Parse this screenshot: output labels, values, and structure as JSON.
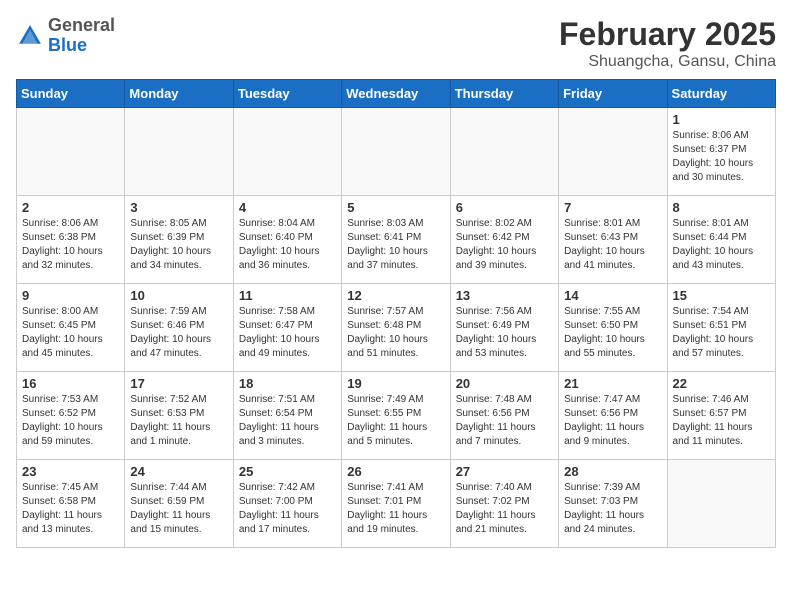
{
  "header": {
    "logo_general": "General",
    "logo_blue": "Blue",
    "month_title": "February 2025",
    "location": "Shuangcha, Gansu, China"
  },
  "weekdays": [
    "Sunday",
    "Monday",
    "Tuesday",
    "Wednesday",
    "Thursday",
    "Friday",
    "Saturday"
  ],
  "weeks": [
    [
      {
        "day": "",
        "info": ""
      },
      {
        "day": "",
        "info": ""
      },
      {
        "day": "",
        "info": ""
      },
      {
        "day": "",
        "info": ""
      },
      {
        "day": "",
        "info": ""
      },
      {
        "day": "",
        "info": ""
      },
      {
        "day": "1",
        "info": "Sunrise: 8:06 AM\nSunset: 6:37 PM\nDaylight: 10 hours and 30 minutes."
      }
    ],
    [
      {
        "day": "2",
        "info": "Sunrise: 8:06 AM\nSunset: 6:38 PM\nDaylight: 10 hours and 32 minutes."
      },
      {
        "day": "3",
        "info": "Sunrise: 8:05 AM\nSunset: 6:39 PM\nDaylight: 10 hours and 34 minutes."
      },
      {
        "day": "4",
        "info": "Sunrise: 8:04 AM\nSunset: 6:40 PM\nDaylight: 10 hours and 36 minutes."
      },
      {
        "day": "5",
        "info": "Sunrise: 8:03 AM\nSunset: 6:41 PM\nDaylight: 10 hours and 37 minutes."
      },
      {
        "day": "6",
        "info": "Sunrise: 8:02 AM\nSunset: 6:42 PM\nDaylight: 10 hours and 39 minutes."
      },
      {
        "day": "7",
        "info": "Sunrise: 8:01 AM\nSunset: 6:43 PM\nDaylight: 10 hours and 41 minutes."
      },
      {
        "day": "8",
        "info": "Sunrise: 8:01 AM\nSunset: 6:44 PM\nDaylight: 10 hours and 43 minutes."
      }
    ],
    [
      {
        "day": "9",
        "info": "Sunrise: 8:00 AM\nSunset: 6:45 PM\nDaylight: 10 hours and 45 minutes."
      },
      {
        "day": "10",
        "info": "Sunrise: 7:59 AM\nSunset: 6:46 PM\nDaylight: 10 hours and 47 minutes."
      },
      {
        "day": "11",
        "info": "Sunrise: 7:58 AM\nSunset: 6:47 PM\nDaylight: 10 hours and 49 minutes."
      },
      {
        "day": "12",
        "info": "Sunrise: 7:57 AM\nSunset: 6:48 PM\nDaylight: 10 hours and 51 minutes."
      },
      {
        "day": "13",
        "info": "Sunrise: 7:56 AM\nSunset: 6:49 PM\nDaylight: 10 hours and 53 minutes."
      },
      {
        "day": "14",
        "info": "Sunrise: 7:55 AM\nSunset: 6:50 PM\nDaylight: 10 hours and 55 minutes."
      },
      {
        "day": "15",
        "info": "Sunrise: 7:54 AM\nSunset: 6:51 PM\nDaylight: 10 hours and 57 minutes."
      }
    ],
    [
      {
        "day": "16",
        "info": "Sunrise: 7:53 AM\nSunset: 6:52 PM\nDaylight: 10 hours and 59 minutes."
      },
      {
        "day": "17",
        "info": "Sunrise: 7:52 AM\nSunset: 6:53 PM\nDaylight: 11 hours and 1 minute."
      },
      {
        "day": "18",
        "info": "Sunrise: 7:51 AM\nSunset: 6:54 PM\nDaylight: 11 hours and 3 minutes."
      },
      {
        "day": "19",
        "info": "Sunrise: 7:49 AM\nSunset: 6:55 PM\nDaylight: 11 hours and 5 minutes."
      },
      {
        "day": "20",
        "info": "Sunrise: 7:48 AM\nSunset: 6:56 PM\nDaylight: 11 hours and 7 minutes."
      },
      {
        "day": "21",
        "info": "Sunrise: 7:47 AM\nSunset: 6:56 PM\nDaylight: 11 hours and 9 minutes."
      },
      {
        "day": "22",
        "info": "Sunrise: 7:46 AM\nSunset: 6:57 PM\nDaylight: 11 hours and 11 minutes."
      }
    ],
    [
      {
        "day": "23",
        "info": "Sunrise: 7:45 AM\nSunset: 6:58 PM\nDaylight: 11 hours and 13 minutes."
      },
      {
        "day": "24",
        "info": "Sunrise: 7:44 AM\nSunset: 6:59 PM\nDaylight: 11 hours and 15 minutes."
      },
      {
        "day": "25",
        "info": "Sunrise: 7:42 AM\nSunset: 7:00 PM\nDaylight: 11 hours and 17 minutes."
      },
      {
        "day": "26",
        "info": "Sunrise: 7:41 AM\nSunset: 7:01 PM\nDaylight: 11 hours and 19 minutes."
      },
      {
        "day": "27",
        "info": "Sunrise: 7:40 AM\nSunset: 7:02 PM\nDaylight: 11 hours and 21 minutes."
      },
      {
        "day": "28",
        "info": "Sunrise: 7:39 AM\nSunset: 7:03 PM\nDaylight: 11 hours and 24 minutes."
      },
      {
        "day": "",
        "info": ""
      }
    ]
  ]
}
